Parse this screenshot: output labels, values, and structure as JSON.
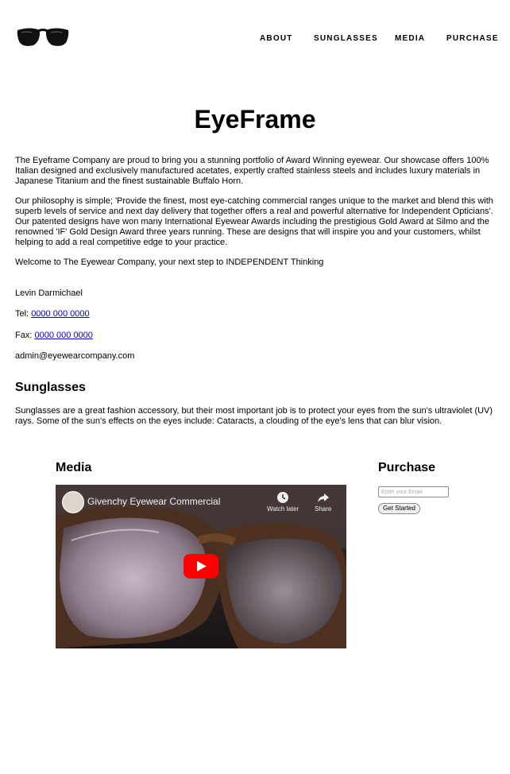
{
  "header": {
    "logo_icon": "sunglasses-icon",
    "nav": [
      {
        "label": "ABOUT"
      },
      {
        "label": "SUNGLASSES"
      },
      {
        "label": "MEDIA"
      },
      {
        "label": "PURCHASE"
      }
    ]
  },
  "about": {
    "title": "EyeFrame",
    "paragraphs": [
      "The Eyeframe Company are proud to bring you a stunning portfolio of Award Winning eyewear. Our showcase offers 100% Italian designed and exclusively manufactured acetates, expertly crafted stainless steels and includes luxury materials in Japanese Titanium and the finest sustainable Buffalo Horn.",
      "Our philosophy is simple; 'Provide the finest, most eye-catching commercial ranges unique to the market and blend this with superb levels of service and next day delivery that together offers a real and powerful alternative for Independent Opticians'.",
      "Our patented designs have won many International Eyewear Awards including the prestigious Gold Award at Silmo and the renowned 'IF' Gold Design Award three years running. These are designs that will inspire you and your customers, whilst helping to add a real competitive edge to your practice.",
      "Welcome to The Eyewear Company, your next step to INDEPENDENT Thinking"
    ]
  },
  "contact": {
    "name": "Levin Darmichael",
    "tel_label": "Tel:",
    "tel": "0000 000 0000",
    "fax_label": "Fax:",
    "fax": "0000 000 0000",
    "email": "admin@eyewearcompany.com"
  },
  "sunglasses": {
    "heading": "Sunglasses",
    "text": "Sunglasses are a great fashion accessory, but their most important job is to protect your eyes from the sun's ultraviolet (UV) rays. Some of the sun's effects on the eyes include: Cataracts, a clouding of the eye's lens that can blur vision."
  },
  "media": {
    "heading": "Media",
    "video_title": "Givenchy Eyewear Commercial",
    "watch_later": "Watch later",
    "share": "Share"
  },
  "purchase": {
    "heading": "Purchase",
    "email_placeholder": "Enter your Email",
    "button_label": "Get Started"
  },
  "colors": {
    "link": "#0000cc",
    "play_button": "#ff0000"
  }
}
